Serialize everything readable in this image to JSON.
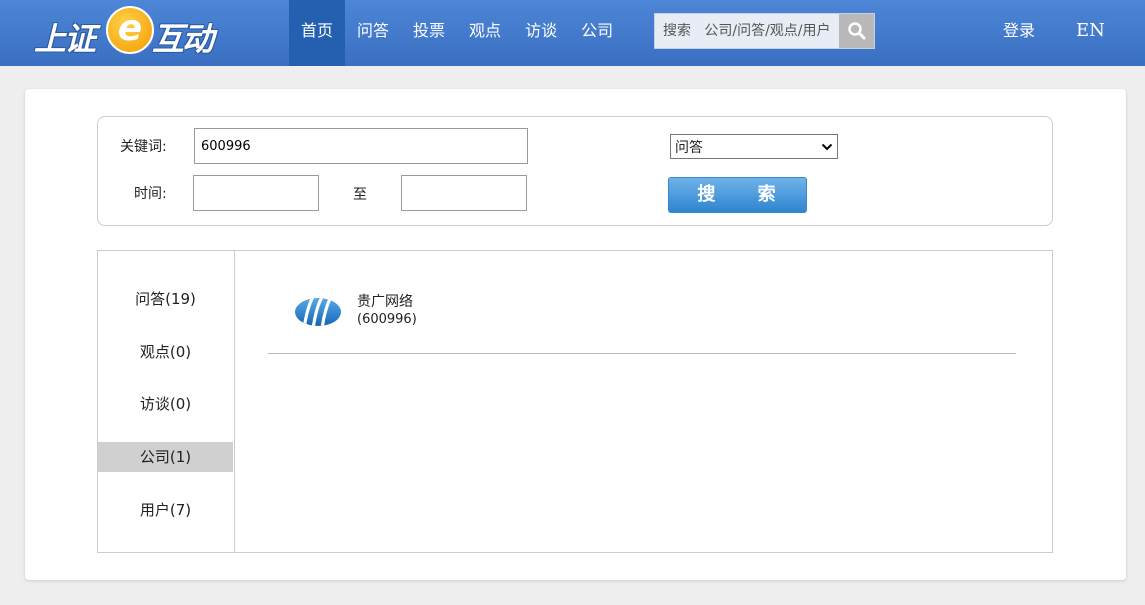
{
  "header": {
    "logo": {
      "left": "上证",
      "mid": "e",
      "right": "互动"
    },
    "nav": [
      "首页",
      "问答",
      "投票",
      "观点",
      "访谈",
      "公司"
    ],
    "search_placeholder": "搜索   公司/问答/观点/用户",
    "login": "登录",
    "lang": "EN"
  },
  "filter": {
    "keyword_label": "关键词:",
    "keyword_value": "600996",
    "time_label": "时间:",
    "to_label": "至",
    "type_selected": "问答",
    "search_button": "搜 索"
  },
  "tabs": [
    {
      "label": "问答(19)"
    },
    {
      "label": "观点(0)"
    },
    {
      "label": "访谈(0)"
    },
    {
      "label": "公司(1)"
    },
    {
      "label": "用户(7)"
    }
  ],
  "active_tab": 3,
  "results": [
    {
      "name": "贵广网络",
      "code": "(600996)"
    }
  ],
  "colors": {
    "header": "#3a6fc2",
    "nav_active": "#2560b0",
    "search_button": "#2f84d0",
    "tab_active": "#d0d0d0"
  }
}
